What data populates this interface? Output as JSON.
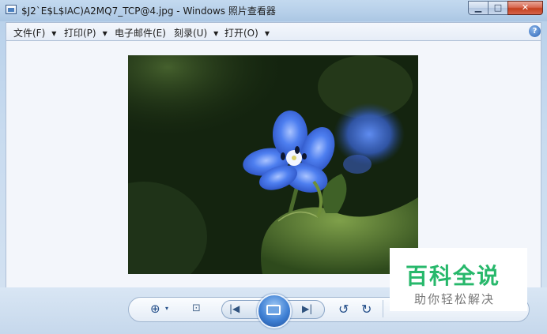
{
  "window": {
    "title": "$J2`E$L$IAC)A2MQ7_TCP@4.jpg - Windows 照片查看器",
    "minimize_glyph": "▁",
    "maximize_glyph": "□",
    "close_glyph": "✕"
  },
  "menubar": {
    "items": [
      {
        "label": "文件(F)",
        "has_dropdown": true
      },
      {
        "label": "打印(P)",
        "has_dropdown": true
      },
      {
        "label": "电子邮件(E)",
        "has_dropdown": false
      },
      {
        "label": "刻录(U)",
        "has_dropdown": true
      },
      {
        "label": "打开(O)",
        "has_dropdown": true
      }
    ],
    "caret": "▼",
    "help_glyph": "?"
  },
  "photo": {
    "subject": "blue forget-me-not flower on dark green background"
  },
  "toolbar": {
    "zoom_glyph": "⊕",
    "zoom_caret": "▾",
    "fit_glyph": "⊡",
    "prev_glyph": "|◀",
    "next_glyph": "▶|",
    "rotate_left_glyph": "↺",
    "rotate_right_glyph": "↻"
  },
  "watermark": {
    "title": "百科全说",
    "subtitle": "助你轻松解决"
  },
  "colors": {
    "flower_blue": "#3a6ee8",
    "watermark_green": "#27b86b"
  }
}
